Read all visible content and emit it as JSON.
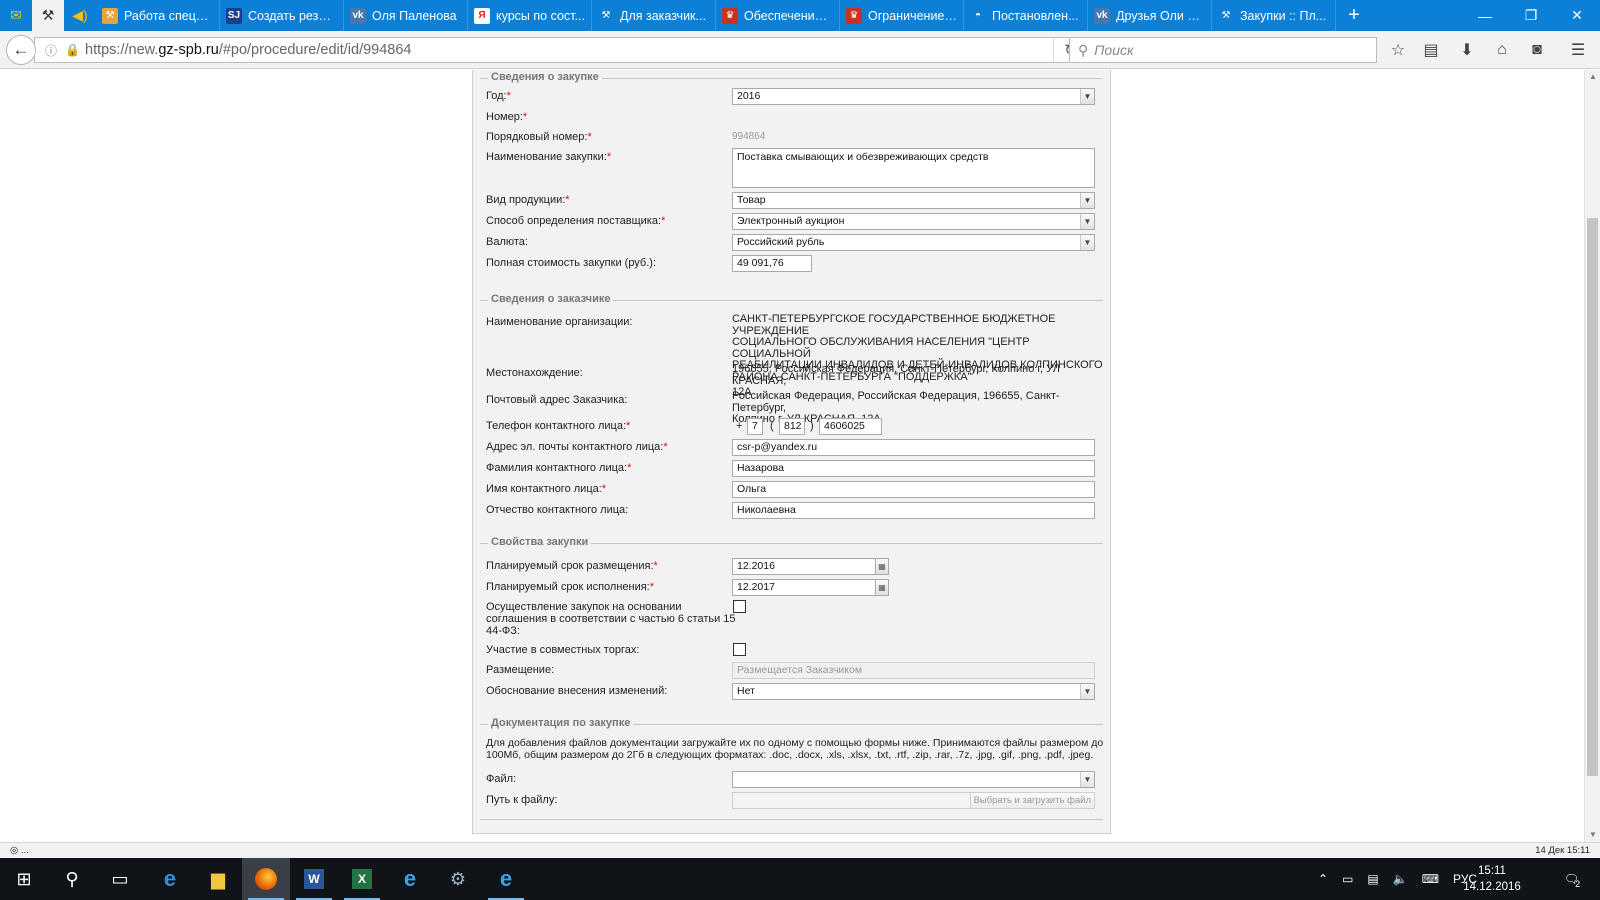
{
  "browser": {
    "pinned_tabs": [
      {
        "icon": "mail-icon",
        "glyph": "✉",
        "active": false
      },
      {
        "icon": "hammer-icon",
        "glyph": "⚒",
        "active": true
      },
      {
        "icon": "speaker-icon",
        "glyph": "🔊",
        "active": false
      }
    ],
    "tabs": [
      {
        "label": "Работа специ...",
        "fav_text": "⚒",
        "fav_bg": "#e8a33d"
      },
      {
        "label": "Создать резю...",
        "fav_text": "SJ",
        "fav_bg": "#1a3d8f"
      },
      {
        "label": "Оля Паленова",
        "fav_text": "vk",
        "fav_bg": "#4a76a8"
      },
      {
        "label": "курсы по сост...",
        "fav_text": "Я",
        "fav_bg": "#ffffff"
      },
      {
        "label": "Для заказчик...",
        "fav_text": "⚒",
        "fav_bg": "transparent"
      },
      {
        "label": "Обеспечение ...",
        "fav_text": "♛",
        "fav_bg": "#c8321e"
      },
      {
        "label": "Ограничение ...",
        "fav_text": "♛",
        "fav_bg": "#c8321e"
      },
      {
        "label": "Постановлен...",
        "fav_text": "◓",
        "fav_bg": "transparent"
      },
      {
        "label": "Друзья Оли П...",
        "fav_text": "vk",
        "fav_bg": "#4a76a8"
      },
      {
        "label": "Закупки :: Пл...",
        "fav_text": "⚒",
        "fav_bg": "transparent"
      }
    ],
    "new_tab": "+",
    "url_prefix": "https://new.",
    "url_domain": "gz-spb.ru",
    "url_path": "/#po/procedure/edit/id/994864",
    "search_placeholder": "Поиск"
  },
  "form": {
    "section1": {
      "legend": "Сведения о закупке",
      "year_label": "Год:",
      "year_value": "2016",
      "number_label": "Номер:",
      "serial_label": "Порядковый номер:",
      "serial_value": "994864",
      "name_label": "Наименование закупки:",
      "name_value": "Поставка смывающих и обезвреживающих средств",
      "product_label": "Вид продукции:",
      "product_value": "Товар",
      "method_label": "Способ определения поставщика:",
      "method_value": "Электронный аукцион",
      "currency_label": "Валюта:",
      "currency_value": "Российский рубль",
      "cost_label": "Полная стоимость закупки (руб.):",
      "cost_value": "49 091,76"
    },
    "section2": {
      "legend": "Сведения о заказчике",
      "org_label": "Наименование организации:",
      "org_lines": [
        "САНКТ-ПЕТЕРБУРГСКОЕ ГОСУДАРСТВЕННОЕ БЮДЖЕТНОЕ УЧРЕЖДЕНИЕ",
        "СОЦИАЛЬНОГО ОБСЛУЖИВАНИЯ НАСЕЛЕНИЯ \"ЦЕНТР СОЦИАЛЬНОЙ",
        "РЕАБИЛИТАЦИИ ИНВАЛИДОВ И ДЕТЕЙ-ИНВАЛИДОВ КОЛПИНСКОГО",
        "РАЙОНА САНКТ-ПЕТЕРБУРГА \"ПОДДЕРЖКА\""
      ],
      "location_label": "Местонахождение:",
      "location_lines": [
        "196655, Российская Федерация, Санкт-Петербург, Колпино г, УЛ КРАСНАЯ,",
        "12А"
      ],
      "postal_label": "Почтовый адрес Заказчика:",
      "postal_lines": [
        "Российская Федерация, Российская Федерация, 196655, Санкт-Петербург,",
        "Колпино г, УЛ КРАСНАЯ, 12А"
      ],
      "phone_label": "Телефон контактного лица:",
      "phone_plus": "+",
      "phone_country": "7",
      "phone_paren_open": "(",
      "phone_code": "812",
      "phone_paren_close": ")",
      "phone_number": "4606025",
      "email_label": "Адрес эл. почты контактного лица:",
      "email_value": "csr-p@yandex.ru",
      "surname_label": "Фамилия контактного лица:",
      "surname_value": "Назарова",
      "firstname_label": "Имя контактного лица:",
      "firstname_value": "Ольга",
      "patronymic_label": "Отчество контактного лица:",
      "patronymic_value": "Николаевна"
    },
    "section3": {
      "legend": "Свойства закупки",
      "planned_placement_label": "Планируемый срок размещения:",
      "planned_placement_value": "12.2016",
      "planned_execution_label": "Планируемый срок исполнения:",
      "planned_execution_value": "12.2017",
      "agreement_lines": [
        "Осуществление закупок на основании",
        "соглашения в соответствии с частью 6 статьи 15",
        "44-ФЗ:"
      ],
      "joint_label": "Участие в совместных торгах:",
      "placement_label": "Размещение:",
      "placement_value": "Размещается Заказчиком",
      "change_reason_label": "Обоснование внесения изменений:",
      "change_reason_value": "Нет"
    },
    "section4": {
      "legend": "Документация по закупке",
      "instruction_lines": [
        "Для добавления файлов документации загружайте их по одному с помощью формы ниже. Принимаются файлы размером до",
        "100Мб, общим размером до 2Гб в следующих форматах: .doc, .docx, .xls, .xlsx, .txt, .rtf, .zip, .rar, .7z, .jpg, .gif, .png, .pdf, .jpeg."
      ],
      "file_label": "Файл:",
      "path_label": "Путь к файлу:",
      "upload_button": "Выбрать и загрузить файл"
    },
    "required_mark": "*"
  },
  "status": {
    "left": "◎ ...",
    "right": "14 Дек 15:11"
  },
  "taskbar": {
    "lang": "РУС",
    "time": "15:11",
    "date": "14.12.2016",
    "notifications": "2"
  }
}
